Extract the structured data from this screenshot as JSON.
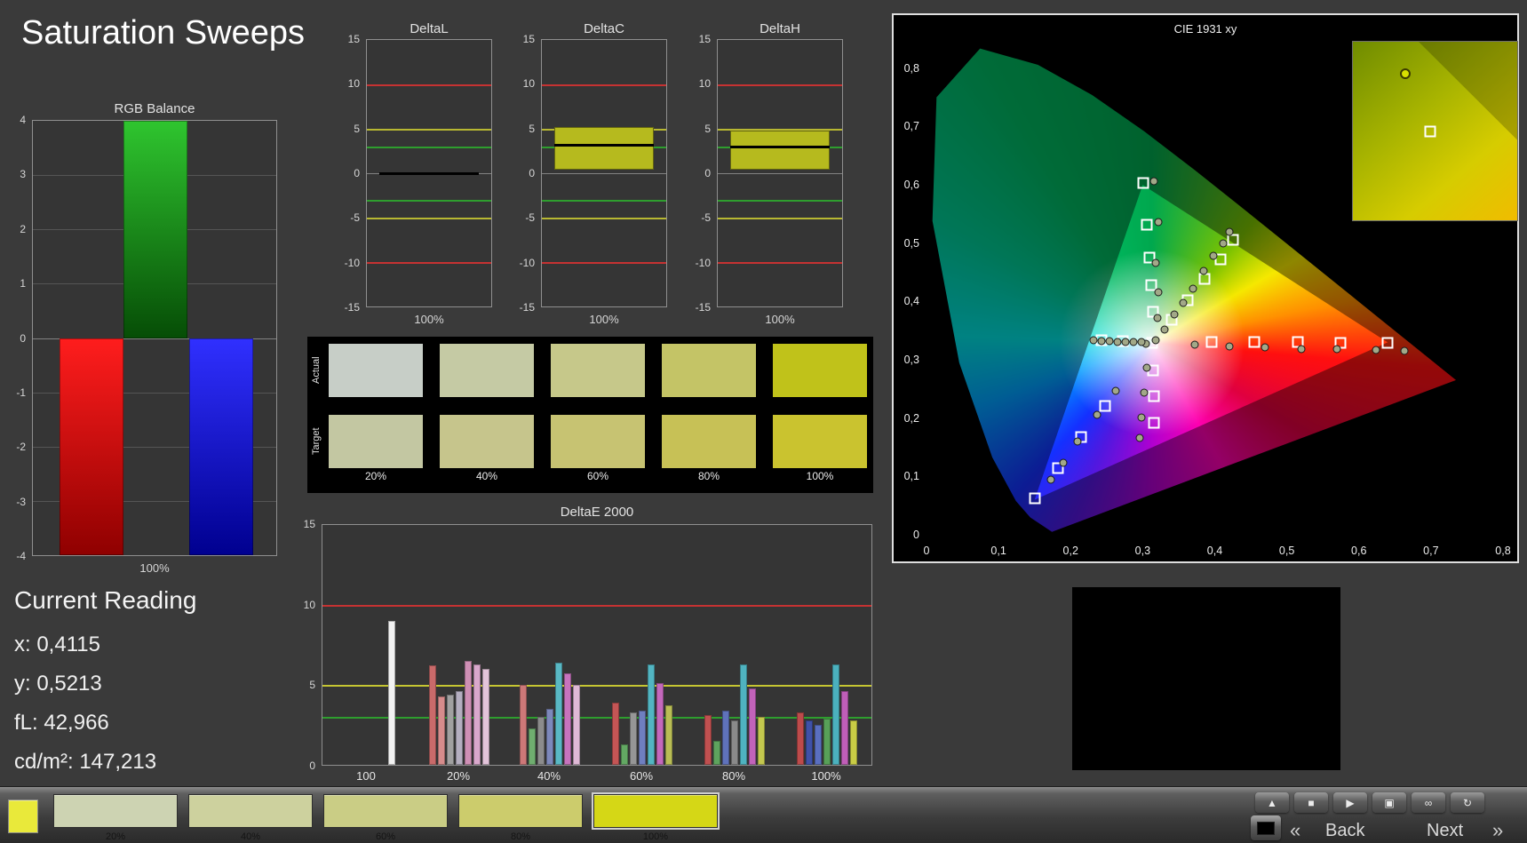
{
  "page": {
    "title": "Saturation Sweeps",
    "bg": "#3a3a3a"
  },
  "rgb_balance": {
    "title": "RGB Balance",
    "x_label": "100%",
    "ylim": [
      -4,
      4
    ],
    "y_ticks": [
      4,
      3,
      2,
      1,
      0,
      -1,
      -2,
      -3,
      -4
    ],
    "bars": [
      {
        "name": "red",
        "value": -4,
        "color_top": "#ff1d1d",
        "color_bottom": "#8f0000"
      },
      {
        "name": "green",
        "value": 4,
        "color_top": "#2fc52f",
        "color_bottom": "#064d06"
      },
      {
        "name": "blue",
        "value": -4,
        "color_top": "#3030ff",
        "color_bottom": "#00008f"
      }
    ]
  },
  "current_reading": {
    "title": "Current Reading",
    "lines": [
      "x: 0,4115",
      "y: 0,5213",
      "fL: 42,966",
      "cd/m²: 147,213"
    ]
  },
  "delta_charts": {
    "ylim": [
      -15,
      15
    ],
    "y_ticks": [
      15,
      10,
      5,
      0,
      -5,
      -10,
      -15
    ],
    "x_label": "100%",
    "ref_lines": [
      {
        "value": 10,
        "color": "#c63232"
      },
      {
        "value": 5,
        "color": "#b8b832"
      },
      {
        "value": 3,
        "color": "#2e9e2e"
      },
      {
        "value": -3,
        "color": "#2e9e2e"
      },
      {
        "value": -5,
        "color": "#b8b832"
      },
      {
        "value": -10,
        "color": "#c63232"
      }
    ],
    "charts": [
      {
        "title": "DeltaL",
        "bar": null,
        "marker": 0,
        "bar_color": "#b6ba1e"
      },
      {
        "title": "DeltaC",
        "bar": [
          0.4,
          5.2
        ],
        "marker": 3.2,
        "bar_color": "#b6ba1e"
      },
      {
        "title": "DeltaH",
        "bar": [
          0.4,
          4.8
        ],
        "marker": 3.0,
        "bar_color": "#b6ba1e"
      }
    ]
  },
  "swatch_table": {
    "row_labels": [
      "Actual",
      "Target"
    ],
    "col_labels": [
      "20%",
      "40%",
      "60%",
      "80%",
      "100%"
    ],
    "actual_colors": [
      "#c7cec7",
      "#c5caa4",
      "#c6c88a",
      "#c4c466",
      "#c0c21a"
    ],
    "target_colors": [
      "#c3c7a2",
      "#c6c58c",
      "#c7c372",
      "#c7c156",
      "#cac32f"
    ]
  },
  "deltae": {
    "title": "DeltaE 2000",
    "ylim": [
      0,
      15
    ],
    "y_ticks": [
      15,
      10,
      5,
      0
    ],
    "ref_lines": [
      {
        "value": 10,
        "color": "#c63232"
      },
      {
        "value": 5,
        "color": "#c6c632"
      },
      {
        "value": 3,
        "color": "#2e9e2e"
      }
    ],
    "groups": [
      {
        "label": "100",
        "bars": [
          {
            "color": "#f2f2f2",
            "value": 9.0
          }
        ]
      },
      {
        "label": "20%",
        "bars": [
          {
            "color": "#c96a6a",
            "value": 6.2
          },
          {
            "color": "#d68c8c",
            "value": 4.3
          },
          {
            "color": "#a0a0a0",
            "value": 4.4
          },
          {
            "color": "#b4aec0",
            "value": 4.6
          },
          {
            "color": "#cf8fb5",
            "value": 6.5
          },
          {
            "color": "#d9a8cc",
            "value": 6.3
          },
          {
            "color": "#e3c4da",
            "value": 6.0
          }
        ]
      },
      {
        "label": "40%",
        "bars": [
          {
            "color": "#cd7878",
            "value": 5.0
          },
          {
            "color": "#6fae6f",
            "value": 2.3
          },
          {
            "color": "#8c8c8c",
            "value": 3.0
          },
          {
            "color": "#7d88bb",
            "value": 3.5
          },
          {
            "color": "#59b8c4",
            "value": 6.4
          },
          {
            "color": "#c773bd",
            "value": 5.7
          },
          {
            "color": "#dfb9d6",
            "value": 5.0
          }
        ]
      },
      {
        "label": "60%",
        "bars": [
          {
            "color": "#c45555",
            "value": 3.9
          },
          {
            "color": "#63a863",
            "value": 1.3
          },
          {
            "color": "#969696",
            "value": 3.3
          },
          {
            "color": "#6f7fc0",
            "value": 3.4
          },
          {
            "color": "#52b5c2",
            "value": 6.3
          },
          {
            "color": "#c468bc",
            "value": 5.1
          },
          {
            "color": "#b9bd55",
            "value": 3.7
          }
        ]
      },
      {
        "label": "80%",
        "bars": [
          {
            "color": "#c05050",
            "value": 3.1
          },
          {
            "color": "#5ea35e",
            "value": 1.5
          },
          {
            "color": "#5f72bb",
            "value": 3.4
          },
          {
            "color": "#8a8a8a",
            "value": 2.8
          },
          {
            "color": "#4fb3c0",
            "value": 6.3
          },
          {
            "color": "#c263ba",
            "value": 4.8
          },
          {
            "color": "#c3c74e",
            "value": 3.0
          }
        ]
      },
      {
        "label": "100%",
        "bars": [
          {
            "color": "#bd4b4b",
            "value": 3.3
          },
          {
            "color": "#3f51a8",
            "value": 2.8
          },
          {
            "color": "#5a6fc0",
            "value": 2.5
          },
          {
            "color": "#58a058",
            "value": 2.9
          },
          {
            "color": "#4bb1be",
            "value": 6.3
          },
          {
            "color": "#c05eb8",
            "value": 4.6
          },
          {
            "color": "#c9cc45",
            "value": 2.8
          }
        ]
      }
    ]
  },
  "cie": {
    "title": "CIE 1931 xy",
    "x_ticks": [
      "0",
      "0,1",
      "0,2",
      "0,3",
      "0,4",
      "0,5",
      "0,6",
      "0,7",
      "0,8"
    ],
    "y_ticks": [
      "0",
      "0,1",
      "0,2",
      "0,3",
      "0,4",
      "0,5",
      "0,6",
      "0,7",
      "0,8"
    ],
    "gamut_triangle": [
      [
        0.64,
        0.33
      ],
      [
        0.3,
        0.6
      ],
      [
        0.15,
        0.06
      ]
    ],
    "targets": [
      [
        0.313,
        0.329
      ],
      [
        0.396,
        0.33
      ],
      [
        0.455,
        0.33
      ],
      [
        0.515,
        0.33
      ],
      [
        0.575,
        0.329
      ],
      [
        0.64,
        0.329
      ],
      [
        0.272,
        0.332
      ],
      [
        0.243,
        0.333
      ],
      [
        0.314,
        0.382
      ],
      [
        0.312,
        0.428
      ],
      [
        0.31,
        0.476
      ],
      [
        0.306,
        0.532
      ],
      [
        0.301,
        0.603
      ],
      [
        0.34,
        0.368
      ],
      [
        0.362,
        0.402
      ],
      [
        0.386,
        0.438
      ],
      [
        0.408,
        0.472
      ],
      [
        0.425,
        0.506
      ],
      [
        0.314,
        0.282
      ],
      [
        0.315,
        0.237
      ],
      [
        0.316,
        0.192
      ],
      [
        0.248,
        0.221
      ],
      [
        0.215,
        0.168
      ],
      [
        0.183,
        0.114
      ],
      [
        0.15,
        0.062
      ]
    ],
    "measurements": [
      [
        0.318,
        0.334
      ],
      [
        0.305,
        0.328
      ],
      [
        0.298,
        0.33
      ],
      [
        0.287,
        0.33
      ],
      [
        0.276,
        0.331
      ],
      [
        0.265,
        0.331
      ],
      [
        0.254,
        0.332
      ],
      [
        0.243,
        0.332
      ],
      [
        0.232,
        0.333
      ],
      [
        0.32,
        0.371
      ],
      [
        0.322,
        0.416
      ],
      [
        0.318,
        0.466
      ],
      [
        0.322,
        0.536
      ],
      [
        0.316,
        0.607
      ],
      [
        0.33,
        0.352
      ],
      [
        0.344,
        0.378
      ],
      [
        0.356,
        0.398
      ],
      [
        0.37,
        0.422
      ],
      [
        0.385,
        0.452
      ],
      [
        0.398,
        0.478
      ],
      [
        0.412,
        0.5
      ],
      [
        0.42,
        0.52
      ],
      [
        0.372,
        0.326
      ],
      [
        0.42,
        0.323
      ],
      [
        0.47,
        0.321
      ],
      [
        0.52,
        0.319
      ],
      [
        0.57,
        0.318
      ],
      [
        0.624,
        0.317
      ],
      [
        0.663,
        0.316
      ],
      [
        0.306,
        0.287
      ],
      [
        0.302,
        0.243
      ],
      [
        0.298,
        0.201
      ],
      [
        0.296,
        0.166
      ],
      [
        0.262,
        0.247
      ],
      [
        0.237,
        0.205
      ],
      [
        0.21,
        0.16
      ],
      [
        0.19,
        0.124
      ],
      [
        0.173,
        0.095
      ]
    ],
    "inset": {
      "circle": [
        0.32,
        0.18
      ],
      "square": [
        0.47,
        0.5
      ]
    }
  },
  "bottom_bar": {
    "corner_color": "#e9e93a",
    "selected": "100%",
    "swatches": [
      {
        "label": "20%",
        "color": "#cdd3b2"
      },
      {
        "label": "40%",
        "color": "#cdd19e"
      },
      {
        "label": "60%",
        "color": "#cacd85"
      },
      {
        "label": "80%",
        "color": "#cccc6c"
      },
      {
        "label": "100%",
        "color": "#d5d716"
      }
    ],
    "buttons": [
      {
        "name": "eject-button",
        "icon": "eject-icon",
        "glyph": "▲"
      },
      {
        "name": "stop-button",
        "icon": "stop-icon",
        "glyph": "■"
      },
      {
        "name": "play-button",
        "icon": "play-icon",
        "glyph": "▶"
      },
      {
        "name": "pattern-button",
        "icon": "pattern-icon",
        "glyph": "▣"
      },
      {
        "name": "continuous-button",
        "icon": "infinity-icon",
        "glyph": "∞"
      },
      {
        "name": "refresh-button",
        "icon": "refresh-icon",
        "glyph": "↻"
      }
    ],
    "back_chevron": "«",
    "back_label": "Back",
    "next_label": "Next",
    "next_chevron": "»"
  }
}
